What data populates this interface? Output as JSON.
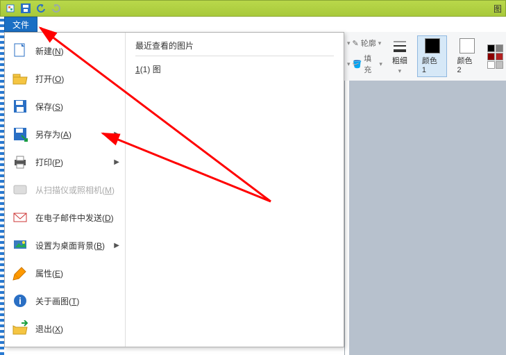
{
  "title_hint": "图",
  "ribbon_tab": "文件",
  "menu": [
    {
      "label": "新建(N)",
      "icon": "new",
      "sub": false,
      "disabled": false
    },
    {
      "label": "打开(O)",
      "icon": "open",
      "sub": false,
      "disabled": false
    },
    {
      "label": "保存(S)",
      "icon": "save",
      "sub": false,
      "disabled": false
    },
    {
      "label": "另存为(A)",
      "icon": "saveas",
      "sub": true,
      "disabled": false
    },
    {
      "label": "打印(P)",
      "icon": "print",
      "sub": true,
      "disabled": false
    },
    {
      "label": "从扫描仪或照相机(M)",
      "icon": "scanner",
      "sub": false,
      "disabled": true
    },
    {
      "label": "在电子邮件中发送(D)",
      "icon": "mail",
      "sub": false,
      "disabled": false
    },
    {
      "label": "设置为桌面背景(B)",
      "icon": "wallpaper",
      "sub": true,
      "disabled": false
    },
    {
      "label": "属性(E)",
      "icon": "props",
      "sub": false,
      "disabled": false
    },
    {
      "label": "关于画图(T)",
      "icon": "about",
      "sub": false,
      "disabled": false
    },
    {
      "label": "退出(X)",
      "icon": "exit",
      "sub": false,
      "disabled": false
    }
  ],
  "recent": {
    "title": "最近查看的图片",
    "items": [
      "1(1) 图"
    ]
  },
  "ribbon": {
    "outline": "轮廓",
    "fill": "填充",
    "stroke": "粗细",
    "color1": "颜色 1",
    "color2": "颜色 2",
    "colors": {
      "c1": "#000000",
      "c2": "#ffffff"
    },
    "palette": [
      "#000000",
      "#808080",
      "#8b0000",
      "#b22222",
      "#ffffff",
      "#c0c0c0"
    ]
  }
}
